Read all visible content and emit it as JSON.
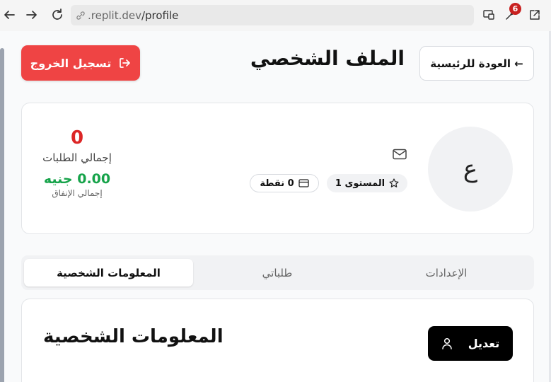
{
  "browser": {
    "url_prefix": ".replit.dev",
    "url_path": "/profile",
    "extension_badge": "6"
  },
  "header": {
    "logout_label": "تسجيل الخروج",
    "title": "الملف الشخصي",
    "back_label": "← العودة للرئيسية"
  },
  "profile": {
    "avatar_initial": "ع",
    "level": "المستوى 1",
    "points": "0 نقطة",
    "stats": {
      "orders_value": "0",
      "orders_label": "إجمالي الطلبات",
      "spent_value": "0.00 جنيه",
      "spent_label": "إجمالي الإنفاق"
    }
  },
  "tabs": [
    {
      "label": "الإعدادات",
      "active": false
    },
    {
      "label": "طلباتي",
      "active": false
    },
    {
      "label": "المعلومات الشخصية",
      "active": true
    }
  ],
  "info_card": {
    "title": "المعلومات الشخصية",
    "edit_label": "تعديل"
  },
  "colors": {
    "logout_bg": "#ef4444",
    "orders_value": "#dc2626",
    "spent_value": "#16a34a",
    "edit_bg": "#000000"
  },
  "icons": [
    "back-arrow-icon",
    "forward-arrow-icon",
    "reload-icon",
    "link-icon",
    "cast-icon",
    "extension-icon",
    "open-external-icon",
    "logout-icon",
    "mail-icon",
    "star-icon",
    "card-icon",
    "user-icon"
  ]
}
